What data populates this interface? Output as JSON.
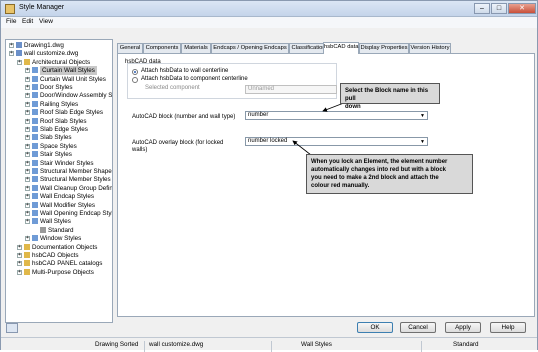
{
  "window": {
    "title": "Style Manager"
  },
  "menu": [
    "File",
    "Edit",
    "View"
  ],
  "tree": {
    "items": [
      {
        "label": "Drawing1.dwg",
        "indent": 0,
        "icon": "drawing-icon"
      },
      {
        "label": "wall customize.dwg",
        "indent": 0,
        "icon": "drawing-icon"
      },
      {
        "label": "Architectural Objects",
        "indent": 1,
        "icon": "folder-icon"
      },
      {
        "label": "Curtain Wall Styles",
        "indent": 2,
        "icon": "style-icon",
        "selected": true
      },
      {
        "label": "Curtain Wall Unit Styles",
        "indent": 2,
        "icon": "style-icon"
      },
      {
        "label": "Door Styles",
        "indent": 2,
        "icon": "style-icon"
      },
      {
        "label": "Door/Window Assembly St",
        "indent": 2,
        "icon": "style-icon"
      },
      {
        "label": "Railing Styles",
        "indent": 2,
        "icon": "style-icon"
      },
      {
        "label": "Roof Slab Edge Styles",
        "indent": 2,
        "icon": "style-icon"
      },
      {
        "label": "Roof Slab Styles",
        "indent": 2,
        "icon": "style-icon"
      },
      {
        "label": "Slab Edge Styles",
        "indent": 2,
        "icon": "style-icon"
      },
      {
        "label": "Slab Styles",
        "indent": 2,
        "icon": "style-icon"
      },
      {
        "label": "Space Styles",
        "indent": 2,
        "icon": "style-icon"
      },
      {
        "label": "Stair Styles",
        "indent": 2,
        "icon": "style-icon"
      },
      {
        "label": "Stair Winder Styles",
        "indent": 2,
        "icon": "style-icon"
      },
      {
        "label": "Structural Member Shape I",
        "indent": 2,
        "icon": "style-icon"
      },
      {
        "label": "Structural Member Styles",
        "indent": 2,
        "icon": "style-icon"
      },
      {
        "label": "Wall Cleanup Group Defini",
        "indent": 2,
        "icon": "style-icon"
      },
      {
        "label": "Wall Endcap Styles",
        "indent": 2,
        "icon": "style-icon"
      },
      {
        "label": "Wall Modifier Styles",
        "indent": 2,
        "icon": "style-icon"
      },
      {
        "label": "Wall Opening Endcap Style",
        "indent": 2,
        "icon": "style-icon"
      },
      {
        "label": "Wall Styles",
        "indent": 2,
        "icon": "style-icon"
      },
      {
        "label": "Standard",
        "indent": 3,
        "icon": "wall-icon"
      },
      {
        "label": "Window Styles",
        "indent": 2,
        "icon": "style-icon"
      },
      {
        "label": "Documentation Objects",
        "indent": 1,
        "icon": "folder-icon"
      },
      {
        "label": "hsbCAD Objects",
        "indent": 1,
        "icon": "folder-icon"
      },
      {
        "label": "hsbCAD PANEL catalogs",
        "indent": 1,
        "icon": "folder-icon"
      },
      {
        "label": "Multi-Purpose Objects",
        "indent": 1,
        "icon": "folder-icon"
      }
    ]
  },
  "tabs": [
    "General",
    "Components",
    "Materials",
    "Endcaps / Opening Endcaps",
    "Classifications",
    "hsbCAD data",
    "Display Properties",
    "Version History"
  ],
  "active_tab": "hsbCAD data",
  "panel": {
    "section_label": "hsbCAD data",
    "radio_wall": "Attach hsbData to wall centerline",
    "radio_component": "Attach hsbData to component centerline",
    "selected_component_label": "Selected component",
    "selected_component_value": "Unnamed",
    "block_label": "AutoCAD block (number and wall type)",
    "block_value": "number",
    "overlay_label_1": "AutoCAD overlay block (for locked",
    "overlay_label_2": "walls)",
    "overlay_value": "number locked"
  },
  "notes": {
    "note1_line1": "Select the Block name in this pull",
    "note1_line2": "down",
    "note2_line1": "When you lock an Element, the element number",
    "note2_line2": "automatically changes  into red but with a block",
    "note2_line3": "you need to make a 2nd block and attach the",
    "note2_line4": "colour red manually."
  },
  "buttons": {
    "ok": "OK",
    "cancel": "Cancel",
    "apply": "Apply",
    "help": "Help"
  },
  "status": {
    "s1": "Drawing Sorted",
    "s2": "wall customize.dwg",
    "s3": "Wall Styles",
    "s4": "Standard"
  },
  "colors": {
    "accent": "#2a5db0",
    "note_bg": "#d9d9d9"
  }
}
